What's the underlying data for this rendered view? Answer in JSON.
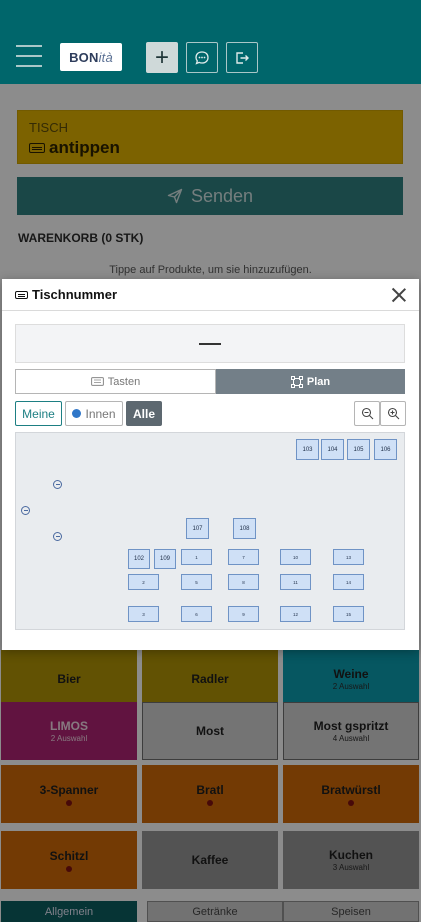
{
  "header": {
    "logo_main": "BON",
    "logo_accent": "ità",
    "icons": [
      "menu-icon",
      "plus-icon",
      "message-icon",
      "logout-icon"
    ]
  },
  "page": {
    "tisch_label": "TISCH",
    "tisch_value": "antippen",
    "send_label": "Senden",
    "warenkorb_label": "WARENKORB (0 STK)",
    "hint": "Tippe auf Produkte, um sie hinzuzufügen."
  },
  "products": [
    {
      "name": "Bier",
      "sub": "",
      "color": "#a98d06"
    },
    {
      "name": "Radler",
      "sub": "",
      "color": "#a98d06"
    },
    {
      "name": "Weine",
      "sub": "2 Auswahl",
      "color": "#0b96a8"
    },
    {
      "name": "LIMOS",
      "sub": "2 Auswahl",
      "color": "#a8226e"
    },
    {
      "name": "Most",
      "sub": "",
      "color": "#c8c8c8"
    },
    {
      "name": "Most gspritzt",
      "sub": "4 Auswahl",
      "color": "#c8c8c8"
    },
    {
      "name": "3-Spanner",
      "sub": "",
      "color": "#c66408"
    },
    {
      "name": "Bratl",
      "sub": "",
      "color": "#c66408"
    },
    {
      "name": "Bratwürstl",
      "sub": "",
      "color": "#c66408"
    },
    {
      "name": "Schitzl",
      "sub": "",
      "color": "#c66408"
    },
    {
      "name": "Kaffee",
      "sub": "",
      "color": "#8f8f8f"
    },
    {
      "name": "Kuchen",
      "sub": "3 Auswahl",
      "color": "#8f8f8f"
    }
  ],
  "bottom_tabs": [
    "Allgemein",
    "Getränke",
    "Speisen"
  ],
  "modal": {
    "title": "Tischnummer",
    "display_value": "—",
    "tab_tasten": "Tasten",
    "tab_plan": "Plan",
    "filter_meine": "Meine",
    "filter_innen": "Innen",
    "filter_alle": "Alle",
    "tables": [
      "103",
      "104",
      "105",
      "106",
      "107",
      "108",
      "102",
      "109",
      "1",
      "4",
      "7",
      "10",
      "13",
      "2",
      "5",
      "8",
      "11",
      "14",
      "3",
      "6",
      "9",
      "12",
      "15"
    ]
  },
  "colors": {
    "header_bg": "#00666b",
    "accent": "#1d7f83",
    "tisch_bg": "#d6a900",
    "send_bg": "#2e7a7b",
    "table_fill": "#cfe0f6",
    "innen_dot": "#3077c9"
  }
}
